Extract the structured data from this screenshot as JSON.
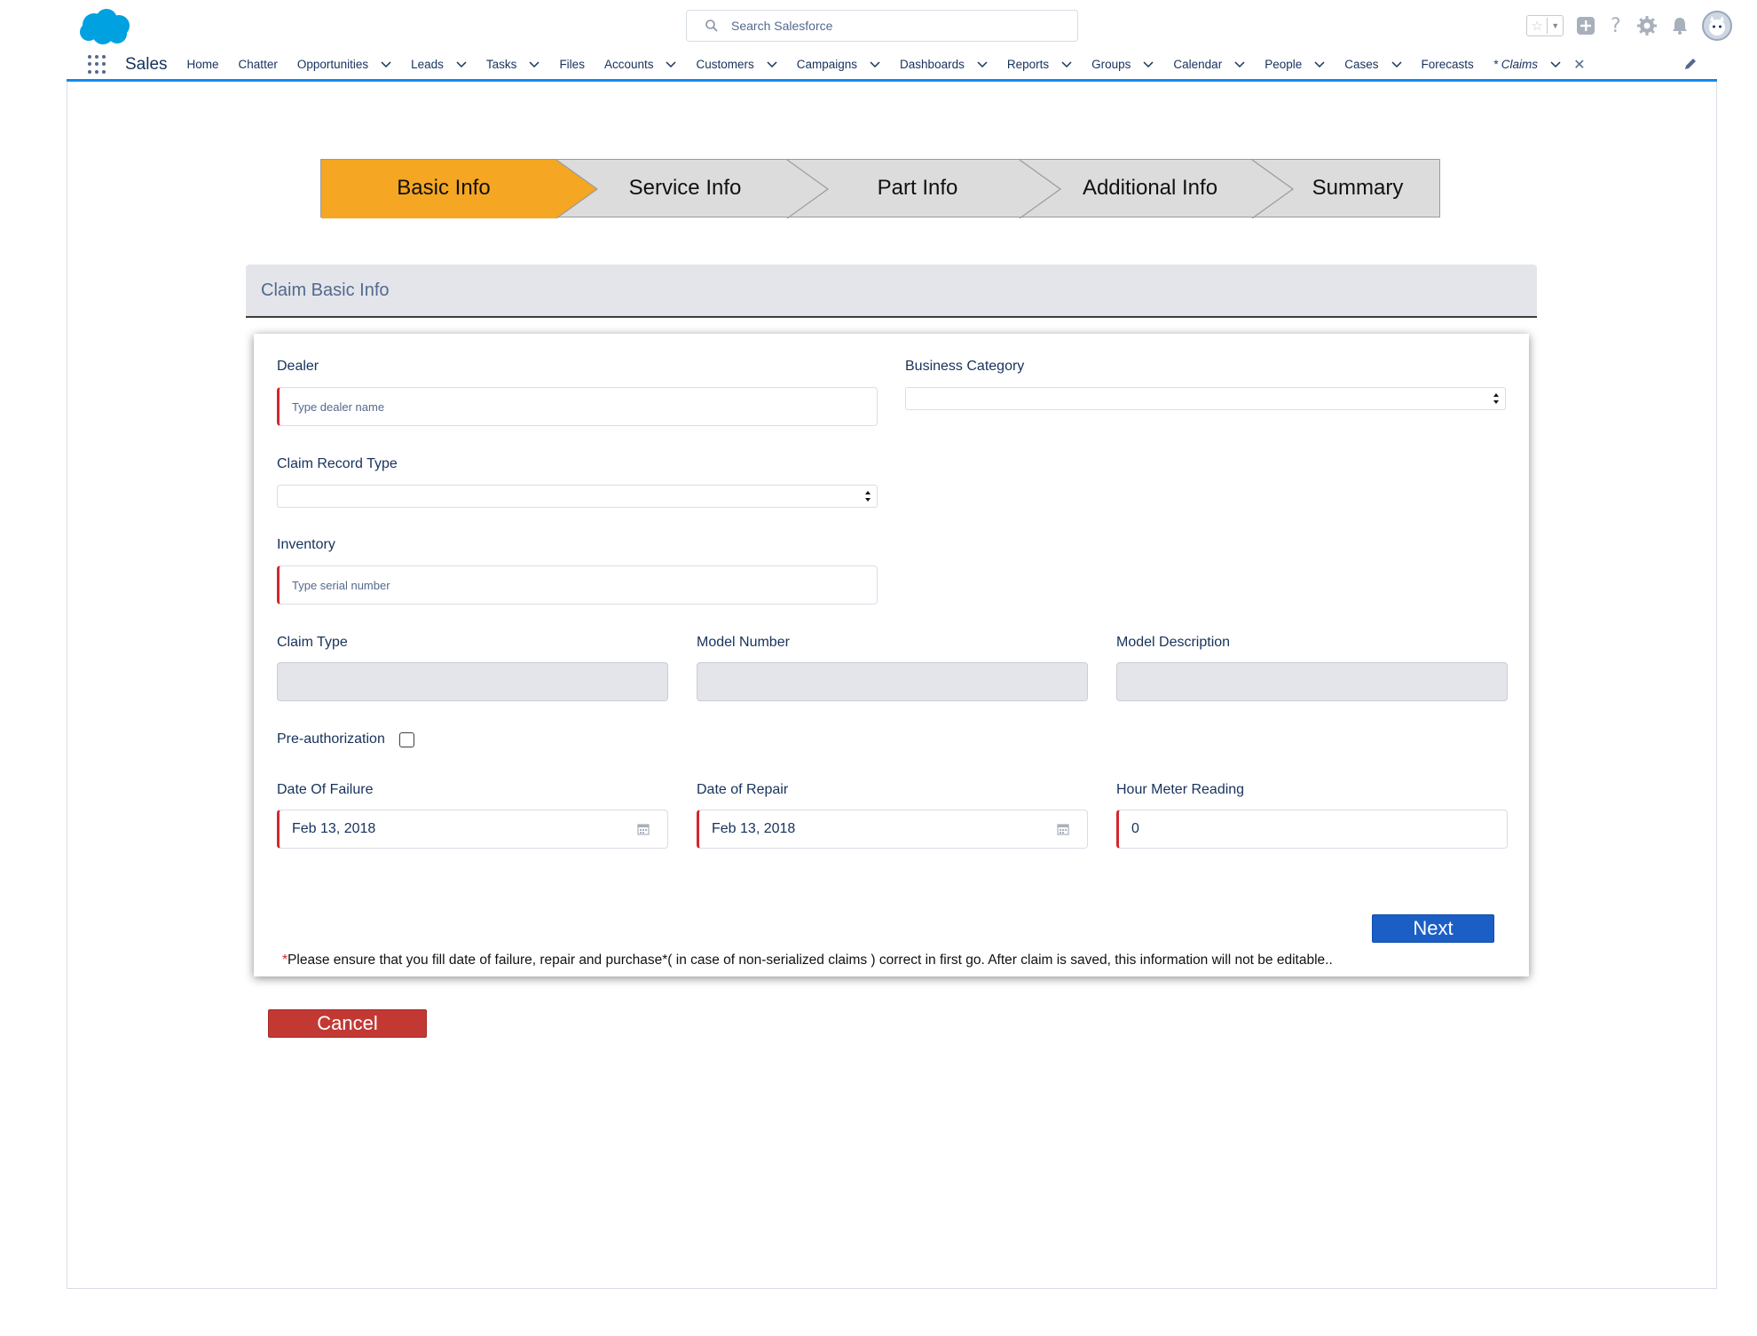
{
  "header": {
    "search_placeholder": "Search Salesforce"
  },
  "nav": {
    "app_name": "Sales",
    "items": [
      {
        "label": "Home",
        "chevron": false
      },
      {
        "label": "Chatter",
        "chevron": false
      },
      {
        "label": "Opportunities",
        "chevron": true
      },
      {
        "label": "Leads",
        "chevron": true
      },
      {
        "label": "Tasks",
        "chevron": true
      },
      {
        "label": "Files",
        "chevron": false
      },
      {
        "label": "Accounts",
        "chevron": true
      },
      {
        "label": "Customers",
        "chevron": true
      },
      {
        "label": "Campaigns",
        "chevron": true
      },
      {
        "label": "Dashboards",
        "chevron": true
      },
      {
        "label": "Reports",
        "chevron": true
      },
      {
        "label": "Groups",
        "chevron": true
      },
      {
        "label": "Calendar",
        "chevron": true
      },
      {
        "label": "People",
        "chevron": true
      },
      {
        "label": "Cases",
        "chevron": true
      },
      {
        "label": "Forecasts",
        "chevron": false
      }
    ],
    "active_tab": "* Claims"
  },
  "steps": [
    "Basic Info",
    "Service Info",
    "Part Info",
    "Additional Info",
    "Summary"
  ],
  "colors": {
    "active_step": "#f5a623",
    "inactive_step": "#dcdcdc",
    "next_button": "#1b5fc6",
    "cancel_button": "#c23934",
    "required_bar": "#d4262c"
  },
  "section": {
    "title": "Claim Basic Info"
  },
  "form": {
    "dealer_label": "Dealer",
    "dealer_placeholder": "Type dealer name",
    "business_category_label": "Business Category",
    "claim_record_type_label": "Claim Record Type",
    "inventory_label": "Inventory",
    "inventory_placeholder": "Type serial number",
    "claim_type_label": "Claim Type",
    "model_number_label": "Model Number",
    "model_description_label": "Model Description",
    "preauth_label": "Pre-authorization",
    "date_failure_label": "Date Of Failure",
    "date_failure_value": "Feb 13, 2018",
    "date_repair_label": "Date of Repair",
    "date_repair_value": "Feb 13, 2018",
    "hour_meter_label": "Hour Meter Reading",
    "hour_meter_value": "0",
    "next_label": "Next",
    "note_star": "*",
    "note_text": "Please ensure that you fill date of failure, repair and purchase*( in case of non-serialized claims ) correct in first go. After claim is saved, this information will not be editable.."
  },
  "cancel_label": "Cancel"
}
